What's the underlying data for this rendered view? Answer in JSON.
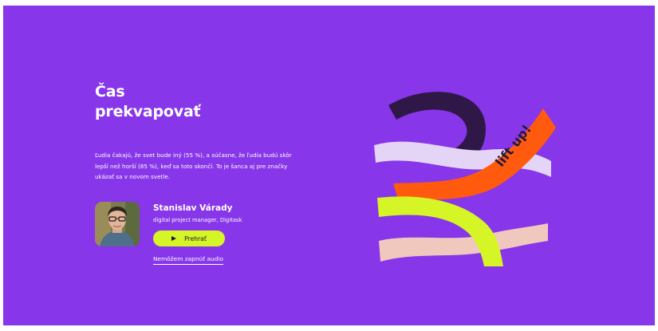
{
  "hero": {
    "title_lines": [
      "Čas",
      "prekvapovať"
    ],
    "body": "Ľudia čakajú, že svet bude iný (55 %), a súčasne, že ľudia budú skôr lepší než horší (85 %), keď sa toto skončí. To je šanca aj pre značky ukázať sa v novom svetle."
  },
  "speaker": {
    "name": "Stanislav Várady",
    "role": "digital project manager, Digitask",
    "play_label": "Prehrať",
    "audio_link": "Nemôžem zapnúť audio"
  },
  "illustration": {
    "sticker_text": "lift up!"
  },
  "colors": {
    "background": "#8736ea",
    "accent_lime": "#d6f526",
    "orange": "#ff5a0e",
    "dark_purple": "#2f1848",
    "lilac": "#e4d4f6",
    "peach": "#f1c8bd"
  }
}
